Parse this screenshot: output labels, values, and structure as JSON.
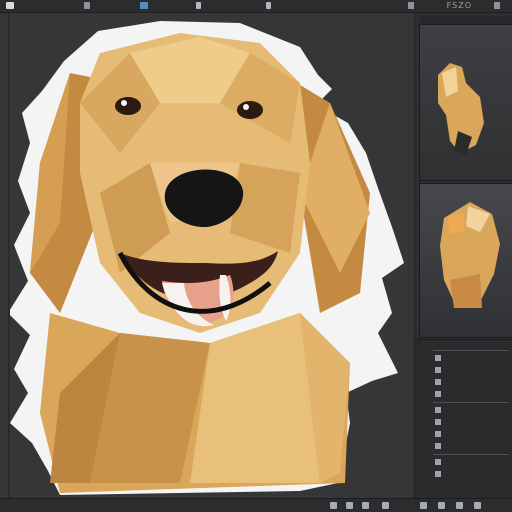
{
  "app": {
    "top_right_title": "FSZO"
  },
  "canvas": {
    "subject_icon": "golden-retriever-lowpoly-artwork"
  },
  "thumbnails": [
    {
      "label": "",
      "icon": "dog-figure-thumbnail"
    },
    {
      "label": "",
      "icon": "dog-figure-thumbnail-alt"
    }
  ],
  "layers_panel": {
    "rows": [
      "",
      "",
      "",
      "",
      "",
      "",
      "",
      "",
      "",
      ""
    ]
  },
  "colors": {
    "ui_dark": "#2b2c2e",
    "ui_panel": "#353638",
    "fur_light": "#e8c07a",
    "fur_mid": "#d9a65a",
    "fur_dark": "#b9813a",
    "nose": "#151515",
    "mouth_inner": "#3a1f1a",
    "tongue": "#e7a089"
  }
}
